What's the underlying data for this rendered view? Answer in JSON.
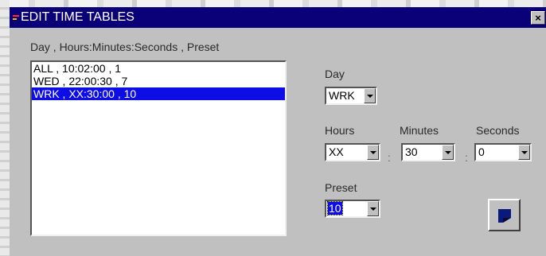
{
  "window": {
    "title": "EDIT TIME TABLES",
    "close_glyph": "×",
    "icon": "app-icon"
  },
  "list": {
    "header": "Day , Hours:Minutes:Seconds , Preset",
    "items": [
      {
        "label": "ALL , 10:02:00 , 1",
        "selected": false
      },
      {
        "label": "WED , 22:00:30 , 7",
        "selected": false
      },
      {
        "label": "WRK , XX:30:00 , 10",
        "selected": true
      }
    ]
  },
  "fields": {
    "day": {
      "label": "Day",
      "value": "WRK"
    },
    "hours": {
      "label": "Hours",
      "value": "XX"
    },
    "minutes": {
      "label": "Minutes",
      "value": "30"
    },
    "seconds": {
      "label": "Seconds",
      "value": "0"
    },
    "preset": {
      "label": "Preset",
      "value": "10"
    },
    "separator": ":"
  },
  "actions": {
    "apply_icon": "save-icon"
  },
  "colors": {
    "titlebar": "#0a0078",
    "selection": "#0d0de6",
    "face": "#c0c0c0"
  }
}
